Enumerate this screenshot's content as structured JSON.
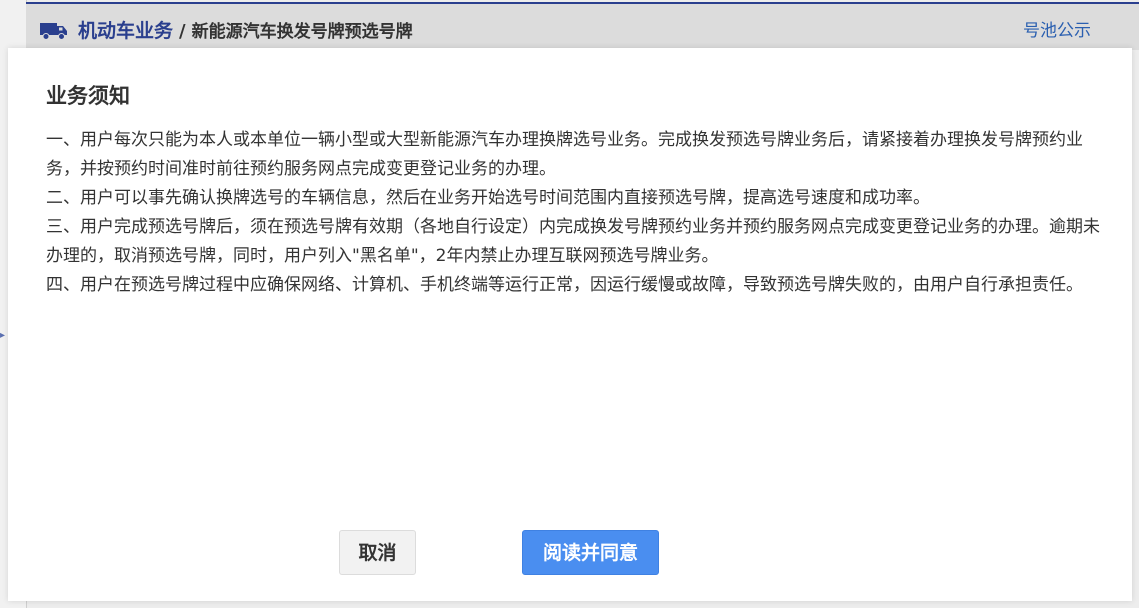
{
  "header": {
    "section": "机动车业务",
    "separator": "/",
    "current": "新能源汽车换发号牌预选号牌",
    "pool_link": "号池公示"
  },
  "modal": {
    "title": "业务须知",
    "paragraphs": [
      "一、用户每次只能为本人或本单位一辆小型或大型新能源汽车办理换牌选号业务。完成换发预选号牌业务后，请紧接着办理换发号牌预约业务，并按预约时间准时前往预约服务网点完成变更登记业务的办理。",
      "二、用户可以事先确认换牌选号的车辆信息，然后在业务开始选号时间范围内直接预选号牌，提高选号速度和成功率。",
      "三、用户完成预选号牌后，须在预选号牌有效期（各地自行设定）内完成换发号牌预约业务并预约服务网点完成变更登记业务的办理。逾期未办理的，取消预选号牌，同时，用户列入\"黑名单\"，2年内禁止办理互联网预选号牌业务。",
      "四、用户在预选号牌过程中应确保网络、计算机、手机终端等运行正常，因运行缓慢或故障，导致预选号牌失败的，由用户自行承担责任。"
    ],
    "cancel_label": "取消",
    "agree_label": "阅读并同意"
  },
  "icons": {
    "truck": "truck-icon"
  },
  "colors": {
    "brand": "#2a3f8e",
    "link": "#2a5fb0",
    "primary_button": "#4a8ef0"
  }
}
